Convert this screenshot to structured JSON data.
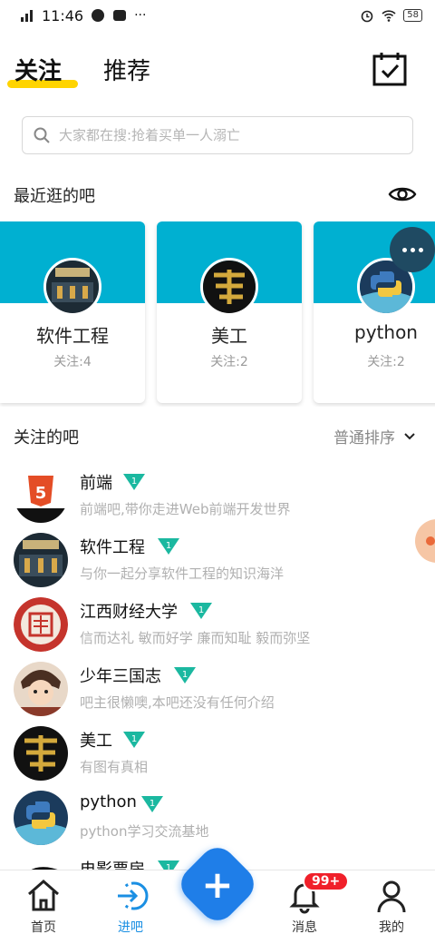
{
  "status_bar": {
    "time": "11:46",
    "battery": "58"
  },
  "header": {
    "tabs": [
      {
        "label": "关注",
        "active": true
      },
      {
        "label": "推荐",
        "active": false
      }
    ]
  },
  "search": {
    "placeholder": "大家都在搜:抢着买单一人溺亡"
  },
  "recent": {
    "title": "最近逛的吧",
    "cards": [
      {
        "name": "软件工程",
        "followers": "关注:4"
      },
      {
        "name": "美工",
        "followers": "关注:2"
      },
      {
        "name": "python",
        "followers": "关注:2"
      }
    ]
  },
  "followed": {
    "title": "关注的吧",
    "sort_label": "普通排序",
    "items": [
      {
        "name": "前端",
        "level": "1",
        "desc": "前端吧,带你走进Web前端开发世界"
      },
      {
        "name": "软件工程",
        "level": "1",
        "desc": "与你一起分享软件工程的知识海洋"
      },
      {
        "name": "江西财经大学",
        "level": "1",
        "desc": "信而达礼 敏而好学 廉而知耻 毅而弥坚"
      },
      {
        "name": "少年三国志",
        "level": "1",
        "desc": "吧主很懒噢,本吧还没有任何介绍"
      },
      {
        "name": "美工",
        "level": "1",
        "desc": "有图有真相"
      },
      {
        "name": "python",
        "level": "1",
        "desc": "python学习交流基地"
      },
      {
        "name": "电影票房",
        "level": "1",
        "desc": ""
      }
    ]
  },
  "bottom_nav": {
    "items": [
      {
        "label": "首页",
        "icon": "home-icon"
      },
      {
        "label": "进吧",
        "icon": "enter-icon"
      },
      {
        "label": "消息",
        "icon": "bell-icon",
        "badge": "99+"
      },
      {
        "label": "我的",
        "icon": "person-icon"
      }
    ]
  },
  "colors": {
    "accent_blue": "#1f7ee8",
    "card_band": "#00b0d1",
    "level_badge": "#1bb8a0",
    "tab_underline": "#ffd400",
    "badge_red": "#f0202a"
  }
}
